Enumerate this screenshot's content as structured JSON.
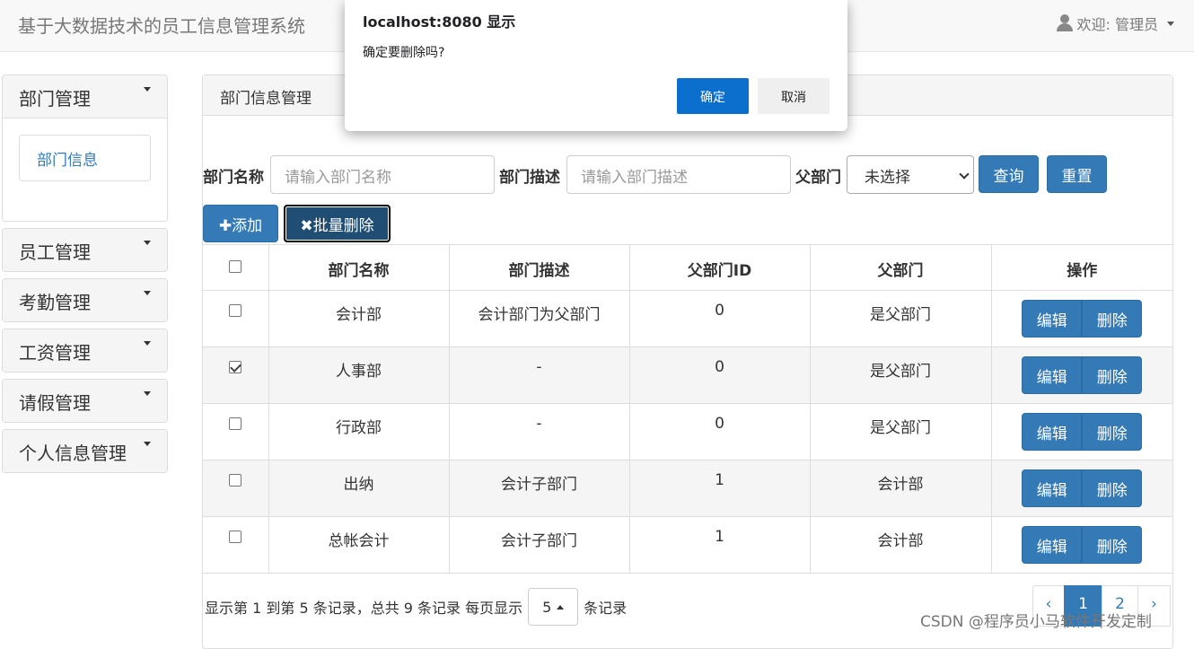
{
  "navbar": {
    "brand": "基于大数据技术的员工信息管理系统",
    "user": "欢迎:  管理员"
  },
  "sidebar": {
    "menus": [
      {
        "label": "部门管理",
        "sub": [
          "部门信息"
        ]
      },
      {
        "label": "员工管理"
      },
      {
        "label": "考勤管理"
      },
      {
        "label": "工资管理"
      },
      {
        "label": "请假管理"
      },
      {
        "label": "个人信息管理"
      }
    ]
  },
  "panel": {
    "title": "部门信息管理"
  },
  "search": {
    "name_label": "部门名称",
    "name_placeholder": "请输入部门名称",
    "desc_label": "部门描述",
    "desc_placeholder": "请输入部门描述",
    "parent_label": "父部门",
    "parent_value": "未选择",
    "query": "查询",
    "reset": "重置"
  },
  "toolbar": {
    "add": "添加",
    "batch_delete": "批量删除"
  },
  "table": {
    "headers": [
      "部门名称",
      "部门描述",
      "父部门ID",
      "父部门",
      "操作"
    ],
    "edit_label": "编辑",
    "delete_label": "删除",
    "rows": [
      {
        "checked": false,
        "name": "会计部",
        "desc": "会计部门为父部门",
        "parent_id": "0",
        "parent": "是父部门"
      },
      {
        "checked": true,
        "name": "人事部",
        "desc": "-",
        "parent_id": "0",
        "parent": "是父部门"
      },
      {
        "checked": false,
        "name": "行政部",
        "desc": "-",
        "parent_id": "0",
        "parent": "是父部门"
      },
      {
        "checked": false,
        "name": "出纳",
        "desc": "会计子部门",
        "parent_id": "1",
        "parent": "会计部"
      },
      {
        "checked": false,
        "name": "总帐会计",
        "desc": "会计子部门",
        "parent_id": "1",
        "parent": "会计部"
      }
    ]
  },
  "footer": {
    "summary": "显示第 1 到第 5 条记录，总共 9 条记录 每页显示",
    "page_size": "5",
    "suffix": "条记录"
  },
  "pager": {
    "prev": "‹",
    "pages": [
      "1",
      "2"
    ],
    "next": "›",
    "current": "1"
  },
  "dialog": {
    "title": "localhost:8080 显示",
    "message": "确定要删除吗?",
    "ok": "确定",
    "cancel": "取消"
  },
  "watermark": "CSDN @程序员小马软件开发定制"
}
